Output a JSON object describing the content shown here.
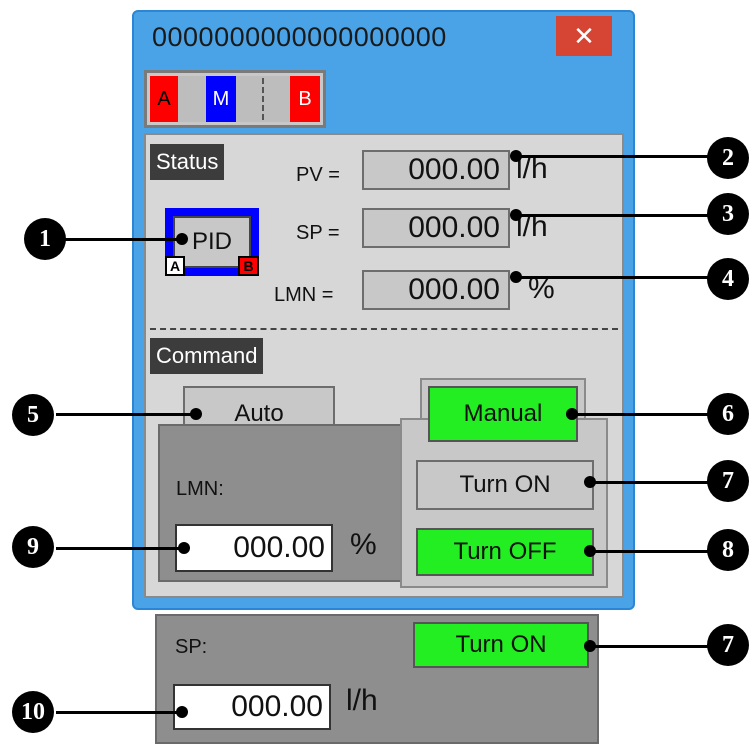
{
  "window": {
    "title": "0000000000000000000",
    "close_label": "✕"
  },
  "mode_strip": {
    "a": "A",
    "m": "M",
    "b": "B"
  },
  "status": {
    "label": "Status",
    "pid": {
      "label": "PID",
      "a": "A",
      "b": "B"
    },
    "pv": {
      "label": "PV =",
      "value": "000.00",
      "unit": "l/h"
    },
    "sp": {
      "label": "SP =",
      "value": "000.00",
      "unit": "l/h"
    },
    "lmn": {
      "label": "LMN =",
      "value": "000.00",
      "unit": "%"
    }
  },
  "command": {
    "label": "Command",
    "auto_button": "Auto",
    "manual_button": "Manual",
    "turn_on_button": "Turn ON",
    "turn_off_button": "Turn OFF",
    "lmn_label": "LMN:",
    "lmn_value": "000.00",
    "lmn_unit": "%"
  },
  "sp_panel": {
    "label": "SP:",
    "turn_on_button": "Turn ON",
    "value": "000.00",
    "unit": "l/h"
  },
  "callouts": [
    "1",
    "2",
    "3",
    "4",
    "5",
    "6",
    "7",
    "8",
    "9",
    "10",
    "7"
  ],
  "colors": {
    "green": "#22ee22",
    "red": "#ff0000",
    "blue": "#0000ff",
    "titlebar": "#4aa3e6"
  }
}
